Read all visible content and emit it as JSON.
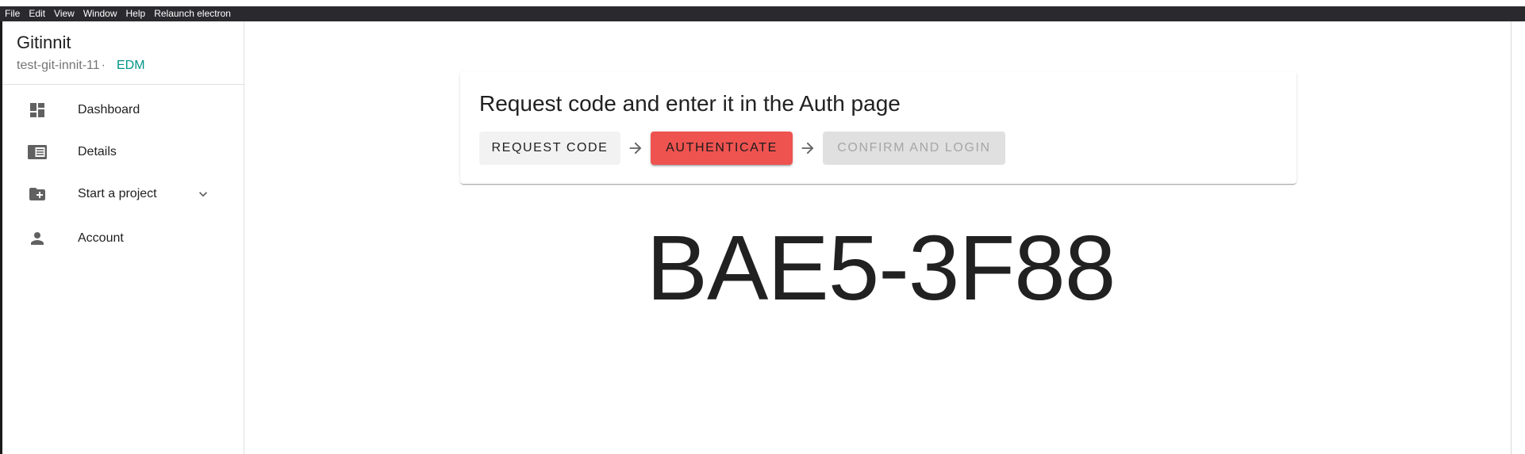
{
  "menubar": {
    "items": [
      "File",
      "Edit",
      "View",
      "Window",
      "Help",
      "Relaunch electron"
    ]
  },
  "sidebar": {
    "app_title": "Gitinnit",
    "project_name": "test-git-innit-11",
    "separator": "·",
    "project_tag": "EDM",
    "items": [
      {
        "label": "Dashboard",
        "icon": "dashboard-icon"
      },
      {
        "label": "Details",
        "icon": "details-icon"
      },
      {
        "label": "Start a project",
        "icon": "folder-add-icon",
        "expandable": true
      },
      {
        "label": "Account",
        "icon": "person-icon"
      }
    ]
  },
  "auth_card": {
    "title": "Request code and enter it in the Auth page",
    "steps": {
      "request_label": "REQUEST CODE",
      "authenticate_label": "AUTHENTICATE",
      "confirm_label": "CONFIRM AND LOGIN"
    }
  },
  "device_code": "BAE5-3F88",
  "colors": {
    "menubar_bg": "#2a2a2e",
    "accent_teal": "#009688",
    "authenticate_bg": "#ef5350",
    "request_bg": "#f2f2f2",
    "confirm_bg_disabled": "#e0e0e0"
  }
}
